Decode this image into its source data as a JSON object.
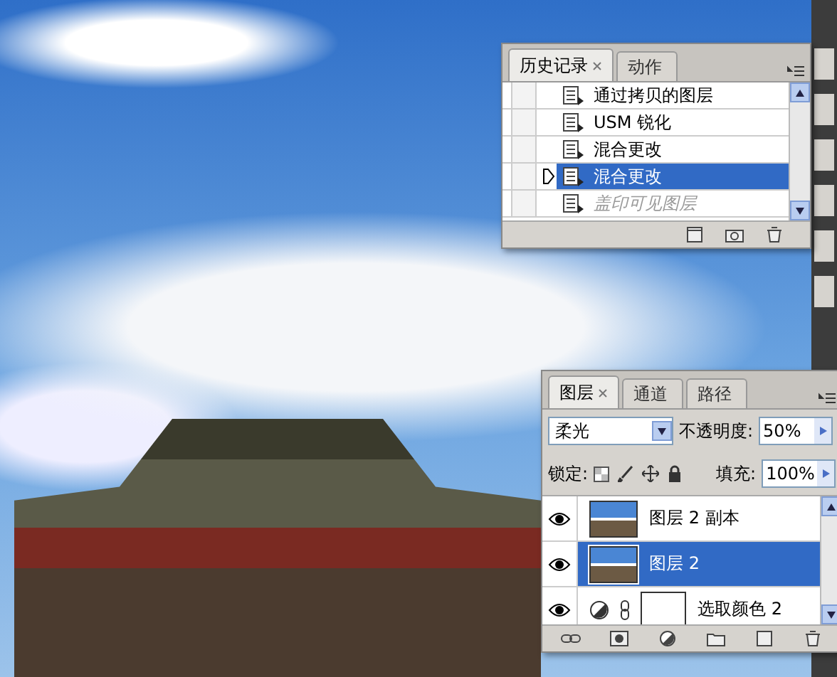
{
  "history_panel": {
    "tabs": [
      {
        "label": "历史记录",
        "selected": true,
        "closable": true
      },
      {
        "label": "动作",
        "selected": false,
        "closable": false
      }
    ],
    "items": [
      {
        "label": "通过拷贝的图层",
        "selected": false,
        "disabled": false,
        "snapshot_checked": false
      },
      {
        "label": "USM 锐化",
        "selected": false,
        "disabled": false,
        "snapshot_checked": false
      },
      {
        "label": "混合更改",
        "selected": false,
        "disabled": false,
        "snapshot_checked": false
      },
      {
        "label": "混合更改",
        "selected": true,
        "disabled": false,
        "snapshot_checked": false
      },
      {
        "label": "盖印可见图层",
        "selected": false,
        "disabled": true,
        "snapshot_checked": false
      }
    ]
  },
  "layers_panel": {
    "tabs": [
      {
        "label": "图层",
        "selected": true,
        "closable": true
      },
      {
        "label": "通道",
        "selected": false,
        "closable": false
      },
      {
        "label": "路径",
        "selected": false,
        "closable": false
      }
    ],
    "blend_mode": "柔光",
    "opacity_label": "不透明度:",
    "opacity": "50%",
    "lock_label": "锁定:",
    "fill_label": "填充:",
    "fill": "100%",
    "layers": [
      {
        "name": "图层 2 副本",
        "kind": "image",
        "visible": true,
        "selected": false
      },
      {
        "name": "图层 2",
        "kind": "image",
        "visible": true,
        "selected": true
      },
      {
        "name": "选取颜色 2",
        "kind": "adjustment",
        "visible": true,
        "selected": false
      }
    ]
  }
}
